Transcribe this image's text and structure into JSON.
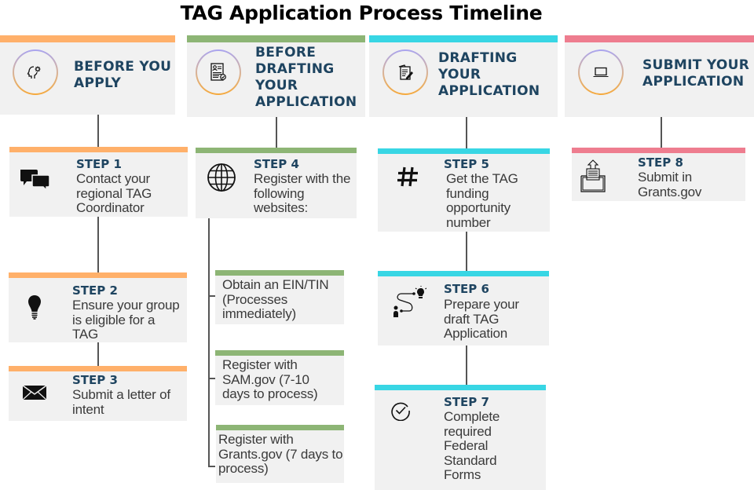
{
  "title": "TAG Application Process Timeline",
  "colors": {
    "phase1": "#ffb06a",
    "phase2": "#8db575",
    "phase3": "#38d6e4",
    "phase4": "#ee7d8f",
    "heading_text": "#1e4460",
    "body_text": "#3a3a3a",
    "box_bg": "#f1f1f1"
  },
  "phases": [
    {
      "title": "BEFORE YOU APPLY",
      "icon": "head-gear-icon"
    },
    {
      "title": "BEFORE DRAFTING YOUR APPLICATION",
      "icon": "resume-document-icon"
    },
    {
      "title": "DRAFTING YOUR APPLICATION",
      "icon": "edit-documents-icon"
    },
    {
      "title": "SUBMIT YOUR APPLICATION",
      "icon": "laptop-icon"
    }
  ],
  "steps": [
    {
      "label": "STEP 1",
      "text": "Contact your regional TAG Coordinator",
      "icon": "chat-bubbles-icon"
    },
    {
      "label": "STEP 2",
      "text": "Ensure your group is eligible for a TAG",
      "icon": "lightbulb-icon"
    },
    {
      "label": "STEP 3",
      "text": "Submit a letter of intent",
      "icon": "envelope-icon"
    },
    {
      "label": "STEP 4",
      "text": "Register with the following websites:",
      "icon": "globe-icon"
    },
    {
      "label": "STEP 5",
      "text": "Get the TAG funding opportunity number",
      "icon": "hashtag-icon"
    },
    {
      "label": "STEP 6",
      "text": "Prepare your draft TAG Application",
      "icon": "path-idea-icon"
    },
    {
      "label": "STEP 7",
      "text": "Complete required Federal Standard Forms",
      "icon": "check-circle-icon"
    },
    {
      "label": "STEP 8",
      "text": "Submit in Grants.gov",
      "icon": "folder-upload-icon"
    }
  ],
  "substeps": [
    "Obtain an EIN/TIN (Processes immediately)",
    "Register with SAM.gov (7-10 days to process)",
    "Register with Grants.gov (7 days to process)"
  ]
}
